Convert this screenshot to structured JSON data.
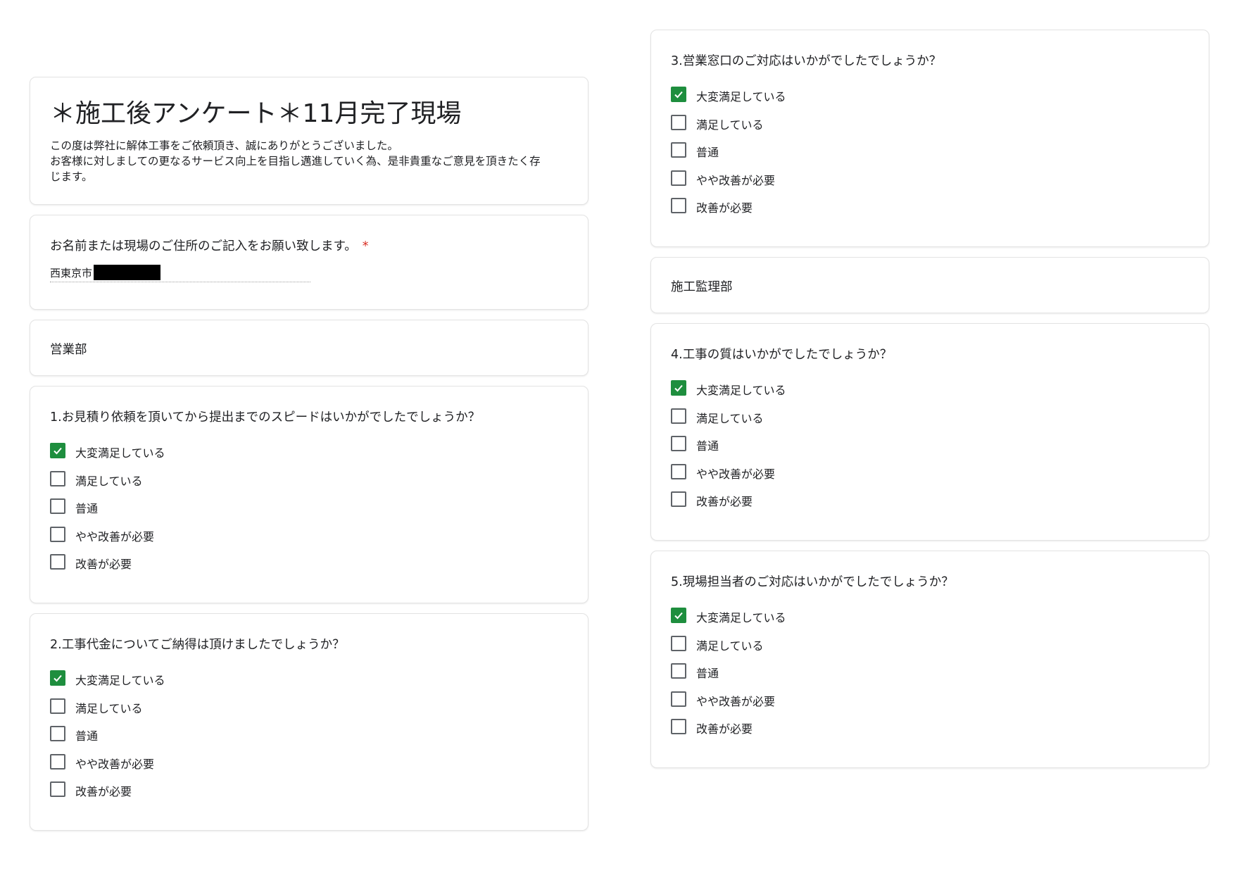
{
  "form": {
    "title": "＊施工後アンケート＊11月完了現場",
    "description": [
      "この度は弊社に解体工事をご依頼頂き、誠にありがとうございました。",
      "お客様に対しましての更なるサービス向上を目指し邁進していく為、是非貴重なご意見を頂きたく存",
      "じます。"
    ]
  },
  "name_question": {
    "title": "お名前または現場のご住所のご記入をお願い致します。",
    "required_mark": "*",
    "answer": "西東京市"
  },
  "sections": {
    "sales": "営業部",
    "construction": "施工監理部"
  },
  "options": [
    "大変満足している",
    "満足している",
    "普通",
    "やや改善が必要",
    "改善が必要"
  ],
  "questions": [
    {
      "title": "1.お見積り依頼を頂いてから提出までのスピードはいかがでしたでしょうか？",
      "checked": [
        true,
        false,
        false,
        false,
        false
      ]
    },
    {
      "title": "2.工事代金についてご納得は頂けましたでしょうか？",
      "checked": [
        true,
        false,
        false,
        false,
        false
      ]
    },
    {
      "title": "3.営業窓口のご対応はいかがでしたでしょうか？",
      "checked": [
        true,
        false,
        false,
        false,
        false
      ]
    },
    {
      "title": "4.工事の質はいかがでしたでしょうか？",
      "checked": [
        true,
        false,
        false,
        false,
        false
      ]
    },
    {
      "title": "5.現場担当者のご対応はいかがでしたでしょうか？",
      "checked": [
        true,
        false,
        false,
        false,
        false
      ]
    }
  ],
  "colors": {
    "checked": "#1e8e3e",
    "required": "#d93025"
  }
}
